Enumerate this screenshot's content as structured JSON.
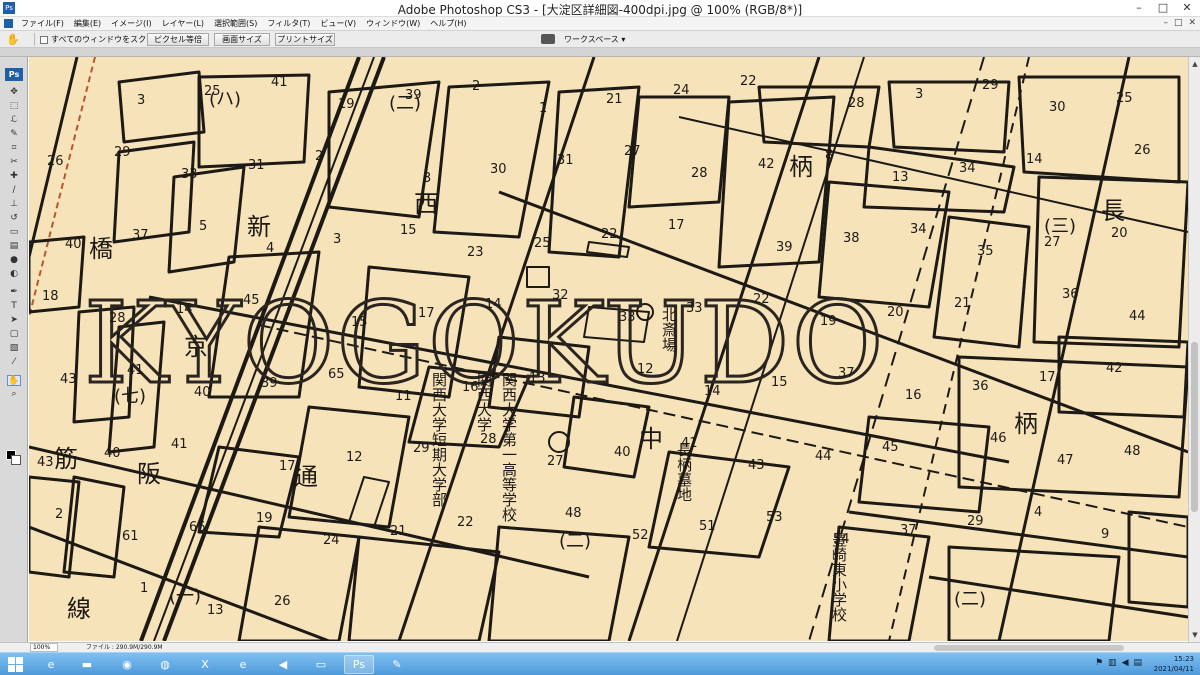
{
  "window": {
    "title": "Adobe Photoshop CS3 - [大淀区詳細図-400dpi.jpg @ 100% (RGB/8*)]",
    "app_icon_text": "Ps",
    "controls": {
      "minimize": "–",
      "maximize": "□",
      "close": "✕"
    }
  },
  "menu": {
    "items": [
      "ファイル(F)",
      "編集(E)",
      "イメージ(I)",
      "レイヤー(L)",
      "選択範囲(S)",
      "フィルタ(T)",
      "ビュー(V)",
      "ウィンドウ(W)",
      "ヘルプ(H)"
    ],
    "right_controls": [
      "–",
      "□",
      "✕"
    ]
  },
  "options": {
    "scroll_all_label": "すべてのウィンドウをスクロール",
    "actual_pixels": "ピクセル等倍",
    "fit_screen": "画面サイズ",
    "print_size": "プリントサイズ",
    "workspace": "ワークスペース ▾"
  },
  "toolbox": {
    "logo": "Ps",
    "tools": [
      {
        "name": "move-tool-icon",
        "glyph": "✥"
      },
      {
        "name": "marquee-tool-icon",
        "glyph": "⬚"
      },
      {
        "name": "lasso-tool-icon",
        "glyph": "ℒ"
      },
      {
        "name": "quick-select-tool-icon",
        "glyph": "✎"
      },
      {
        "name": "crop-tool-icon",
        "glyph": "⌗"
      },
      {
        "name": "slice-tool-icon",
        "glyph": "✂"
      },
      {
        "name": "healing-tool-icon",
        "glyph": "✚"
      },
      {
        "name": "brush-tool-icon",
        "glyph": "∕"
      },
      {
        "name": "stamp-tool-icon",
        "glyph": "⊥"
      },
      {
        "name": "history-brush-tool-icon",
        "glyph": "↺"
      },
      {
        "name": "eraser-tool-icon",
        "glyph": "▭"
      },
      {
        "name": "gradient-tool-icon",
        "glyph": "▤"
      },
      {
        "name": "blur-tool-icon",
        "glyph": "●"
      },
      {
        "name": "dodge-tool-icon",
        "glyph": "◐"
      },
      {
        "name": "pen-tool-icon",
        "glyph": "✒"
      },
      {
        "name": "type-tool-icon",
        "glyph": "T"
      },
      {
        "name": "path-select-tool-icon",
        "glyph": "➤"
      },
      {
        "name": "shape-tool-icon",
        "glyph": "▢"
      },
      {
        "name": "notes-tool-icon",
        "glyph": "▧"
      },
      {
        "name": "eyedropper-tool-icon",
        "glyph": "⁄"
      },
      {
        "name": "hand-tool-icon",
        "glyph": "✋"
      },
      {
        "name": "zoom-tool-icon",
        "glyph": "⌕"
      }
    ],
    "active_tool": "hand-tool-icon",
    "foreground_color": "#000000",
    "background_color": "#ffffff"
  },
  "map": {
    "watermark": "KYOGOKUDO",
    "paper_color": "#f7e3ba",
    "ink_color": "#1d1a16",
    "kanji": [
      "西",
      "柄",
      "長",
      "橋",
      "新",
      "京",
      "筋",
      "阪",
      "通",
      "線",
      "中",
      "柄",
      "(ハ)",
      "(二)",
      "(三)",
      "(七)",
      "(一)",
      "(二)",
      "(二)"
    ],
    "vertical_texts": [
      "関西大学第一高等学校",
      "関西大学",
      "関西大学短期大学部",
      "長柄墓地",
      "北斎場",
      "豊崎東小学校"
    ],
    "block_numbers": [
      "62",
      "3",
      "25",
      "41",
      "19",
      "39",
      "2",
      "1",
      "21",
      "24",
      "22",
      "28",
      "3",
      "29",
      "30",
      "25",
      "26",
      "29",
      "33",
      "31",
      "2",
      "3",
      "30",
      "31",
      "27",
      "28",
      "42",
      "8",
      "13",
      "34",
      "14",
      "26",
      "40",
      "37",
      "5",
      "4",
      "3",
      "15",
      "23",
      "25",
      "22",
      "17",
      "39",
      "38",
      "34",
      "35",
      "27",
      "20",
      "18",
      "28",
      "14",
      "45",
      "15",
      "17",
      "14",
      "32",
      "33",
      "33",
      "22",
      "19",
      "20",
      "21",
      "36",
      "44",
      "43",
      "41",
      "40",
      "39",
      "65",
      "11",
      "16",
      "13",
      "12",
      "14",
      "15",
      "37",
      "16",
      "36",
      "17",
      "42",
      "43",
      "40",
      "41",
      "17",
      "12",
      "29",
      "28",
      "27",
      "40",
      "41",
      "43",
      "44",
      "45",
      "46",
      "47",
      "48",
      "2",
      "61",
      "66",
      "19",
      "24",
      "21",
      "22",
      "48",
      "52",
      "51",
      "53",
      "54",
      "37",
      "29",
      "4",
      "9",
      "10",
      "1",
      "13",
      "26"
    ]
  },
  "status": {
    "zoom": "100%",
    "file_info": "ファイル : 290.9M/290.9M"
  },
  "taskbar": {
    "apps": [
      {
        "name": "taskbar-ie-icon",
        "glyph": "e"
      },
      {
        "name": "taskbar-explorer-icon",
        "glyph": "▬"
      },
      {
        "name": "taskbar-chrome-icon",
        "glyph": "◉"
      },
      {
        "name": "taskbar-firefox-icon",
        "glyph": "◍"
      },
      {
        "name": "taskbar-excel-icon",
        "glyph": "X"
      },
      {
        "name": "taskbar-edge-icon",
        "glyph": "e"
      },
      {
        "name": "taskbar-audio-icon",
        "glyph": "◀"
      },
      {
        "name": "taskbar-folder-icon",
        "glyph": "▭"
      },
      {
        "name": "taskbar-photoshop-icon",
        "glyph": "Ps"
      },
      {
        "name": "taskbar-paint-icon",
        "glyph": "✎"
      }
    ],
    "time": "15:23",
    "date": "2021/04/11"
  }
}
